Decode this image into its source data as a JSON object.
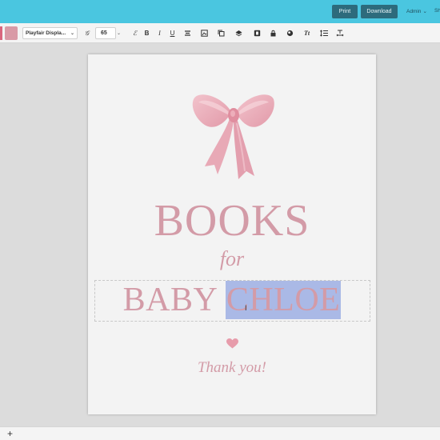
{
  "header": {
    "print_label": "Print",
    "download_label": "Download",
    "admin_label": "Admin",
    "share_label": "Sh",
    "admin_caret": "⌄"
  },
  "toolbar": {
    "font_family": "Playfair Displa...",
    "font_size": "65",
    "color_swatch": "#d99aa6",
    "accent_swatch": "#d9667e",
    "icons": [
      "text-style-icon",
      "bold-icon",
      "italic-icon",
      "underline-icon",
      "align-icon",
      "image-icon",
      "duplicate-icon",
      "layers-icon",
      "position-icon",
      "lock-icon",
      "effects-icon",
      "text-transform-icon",
      "line-spacing-icon",
      "letter-spacing-icon"
    ]
  },
  "page": {
    "line1": "BOOKS",
    "line2": "for",
    "line3_plain": "BABY ",
    "line3_selected": "CHLOE",
    "closing": "Thank you!",
    "text_color": "#d39ba7",
    "selection_color": "#aab9e6"
  },
  "footer": {
    "add_label": "+"
  }
}
